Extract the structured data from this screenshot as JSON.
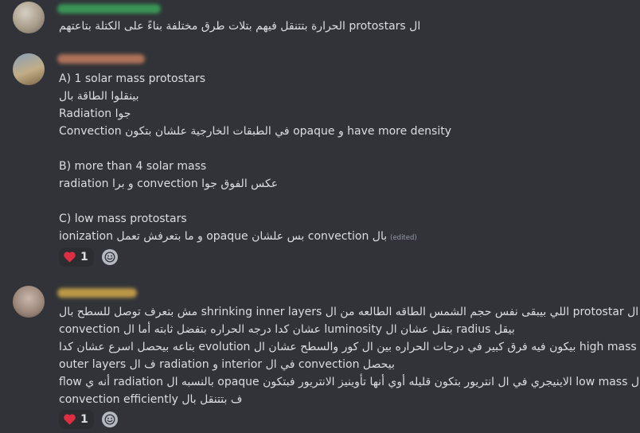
{
  "colors": {
    "background": "#313338",
    "text": "#dbdee1",
    "muted": "#949ba4",
    "reaction_bg": "#2b2d31",
    "heart": "#dd2e44",
    "username_blur_1": "#3ba55c",
    "username_blur_2": "#c27c5e",
    "username_blur_3": "#d4a94a"
  },
  "messages": [
    {
      "lines": [
        "ال protostars الحرارة بتتنقل فيهم بتلات طرق مختلفة بناءً على الكتلة بتاعتهم"
      ]
    },
    {
      "lines": [
        "A) 1 solar mass protostars",
        "بينقلوا الطاقة بال",
        "Radiation جوا",
        "Convection في الطبقات الخارجية علشان بتكون opaque و have more density",
        "B) more than 4 solar mass",
        "radiation و برا convection عكس الفوق جوا",
        "C) low mass protostars",
        "بال convection بس علشان opaque و ما بتعرفش تعمل ionization"
      ],
      "edited_label": "(edited)",
      "reaction": {
        "icon": "heart-icon",
        "count": "1"
      }
    },
    {
      "lines": [
        "ال protostar اللي بيبقى نفس حجم الشمس الطاقه الطالعه من ال shrinking inner layers مش بتعرف توصل للسطح بال",
        "convection عشان كدا درجه الحراره بتفضل ثابته أما ال luminosity بتقل عشان ال radius بيقل",
        "ال high mass بيكون فيه فرق كبير في درجات الحراره بين ال كور والسطح عشان ال evolution بتاعه بيحصل اسرع عشان كدا",
        "بيحصل convection في ال interior و radiation ف ال outer layers",
        "ال low mass الاينيجري في ال انتريور بتكون قليله أوي أنها تأوينيز الانتريور فبتكون opaque بالنسبه ال radiation أنه ي flow",
        "ف بتتنقل بال convection efficiently"
      ],
      "reaction": {
        "icon": "heart-icon",
        "count": "1"
      }
    }
  ]
}
